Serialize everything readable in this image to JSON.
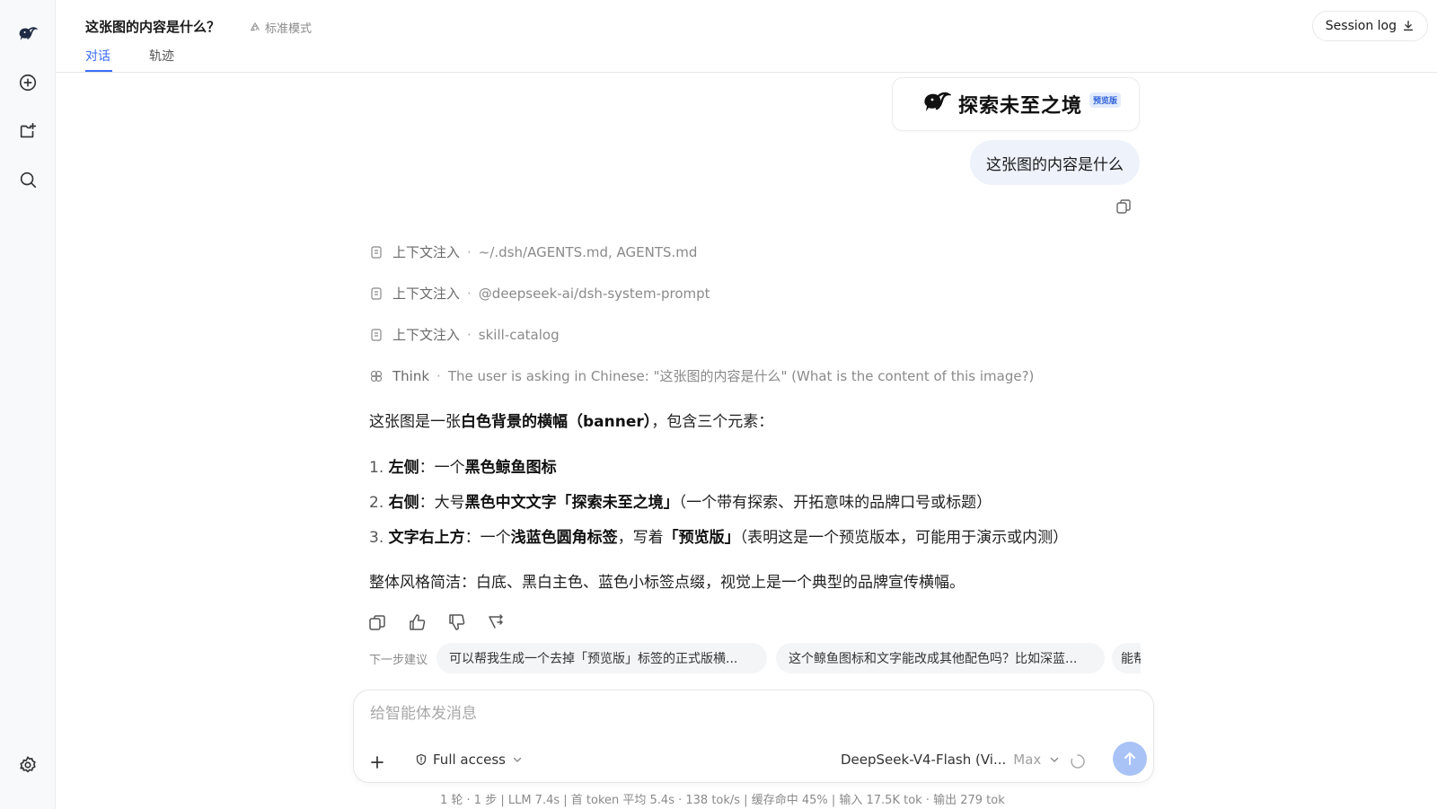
{
  "header": {
    "title": "这张图的内容是什么？",
    "mode": "标准模式",
    "tabs": [
      "对话",
      "轨迹"
    ],
    "session_log": "Session log"
  },
  "banner": {
    "text": "探索未至之境",
    "tag": "预览版"
  },
  "user_message": "这张图的内容是什么",
  "context": [
    {
      "label": "上下文注入",
      "value": "~/.dsh/AGENTS.md, AGENTS.md"
    },
    {
      "label": "上下文注入",
      "value": "@deepseek-ai/dsh-system-prompt"
    },
    {
      "label": "上下文注入",
      "value": "skill-catalog"
    }
  ],
  "think": {
    "label": "Think",
    "value": "The user is asking in Chinese: \"这张图的内容是什么\" (What is the content of this image?)"
  },
  "answer": {
    "intro_a": "这张图是一张",
    "intro_b": "白色背景的横幅（banner）",
    "intro_c": "，包含三个元素：",
    "items": [
      {
        "num": "1.",
        "head": "左侧",
        "p1": "：一个",
        "b1": "黑色鲸鱼图标",
        "p2": "",
        "b2": "",
        "p3": ""
      },
      {
        "num": "2.",
        "head": "右侧",
        "p1": "：大号",
        "b1": "黑色中文文字「探索未至之境」",
        "p2": "（一个带有探索、开拓意味的品牌口号或标题）",
        "b2": "",
        "p3": ""
      },
      {
        "num": "3.",
        "head": "文字右上方",
        "p1": "：一个",
        "b1": "浅蓝色圆角标签",
        "p2": "，写着",
        "b2": "「预览版」",
        "p3": "（表明这是一个预览版本，可能用于演示或内测）"
      }
    ],
    "summary": "整体风格简洁：白底、黑白主色、蓝色小标签点缀，视觉上是一个典型的品牌宣传横幅。"
  },
  "suggestions": {
    "label": "下一步建议",
    "chips": [
      "可以帮我生成一个去掉「预览版」标签的正式版横...",
      "这个鲸鱼图标和文字能改成其他配色吗？比如深蓝...",
      "能帮"
    ]
  },
  "composer": {
    "placeholder": "给智能体发消息",
    "access": "Full access",
    "model": "DeepSeek-V4-Flash (Vi...",
    "effort": "Max"
  },
  "stats": "1 轮 · 1 步   |   LLM 7.4s   |   首 token 平均 5.4s · 138 tok/s   |   缓存命中 45%   |   输入 17.5K tok · 输出 279 tok",
  "colors": {
    "accent": "#3b6cf6",
    "send_button": "#a9c3f7",
    "tag_bg": "#e3ecfd"
  }
}
